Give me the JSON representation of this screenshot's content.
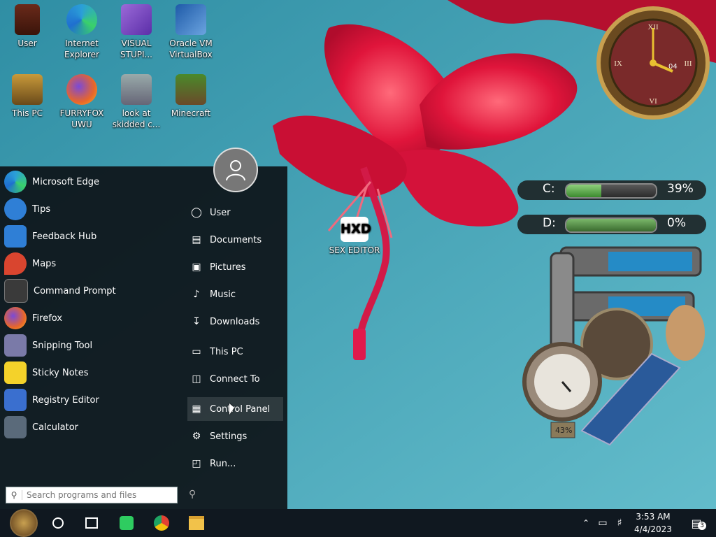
{
  "desktop_icons": [
    {
      "label": "User",
      "icon": "user-folder-icon"
    },
    {
      "label": "Internet Explorer",
      "icon": "edge-icon"
    },
    {
      "label": "VISUAL STUPI...",
      "icon": "visual-studio-icon"
    },
    {
      "label": "Oracle VM VirtualBox",
      "icon": "virtualbox-icon"
    },
    {
      "label": "This PC",
      "icon": "this-pc-icon"
    },
    {
      "label": "FURRYFOX UWU",
      "icon": "firefox-icon"
    },
    {
      "label": "look at skidded c...",
      "icon": "windows-stack-icon"
    },
    {
      "label": "Minecraft",
      "icon": "minecraft-icon"
    },
    {
      "label": "SEX EDITOR",
      "icon": "hxd-icon"
    }
  ],
  "start_menu": {
    "apps": [
      {
        "label": "Microsoft Edge",
        "icon": "edge-icon",
        "color": "#2b9fd8"
      },
      {
        "label": "Tips",
        "icon": "lightbulb-icon",
        "color": "#2f7fd6"
      },
      {
        "label": "Feedback Hub",
        "icon": "feedback-icon",
        "color": "#2f7fd6"
      },
      {
        "label": "Maps",
        "icon": "map-pin-icon",
        "color": "#d9452f"
      },
      {
        "label": "Command Prompt",
        "icon": "cmd-icon",
        "color": "#3a3a3a"
      },
      {
        "label": "Firefox",
        "icon": "firefox-icon",
        "color": "#e8662a"
      },
      {
        "label": "Snipping Tool",
        "icon": "scissors-icon",
        "color": "#7a7aa8"
      },
      {
        "label": "Sticky Notes",
        "icon": "sticky-note-icon",
        "color": "#f4d22a"
      },
      {
        "label": "Registry Editor",
        "icon": "registry-icon",
        "color": "#3a6fcf"
      },
      {
        "label": "Calculator",
        "icon": "calculator-icon",
        "color": "#5a6a7a"
      }
    ],
    "places": [
      {
        "label": "User",
        "icon": "user-icon"
      },
      {
        "label": "Documents",
        "icon": "document-icon"
      },
      {
        "label": "Pictures",
        "icon": "picture-icon"
      },
      {
        "label": "Music",
        "icon": "music-note-icon"
      },
      {
        "label": "Downloads",
        "icon": "download-icon"
      },
      {
        "label": "This PC",
        "icon": "monitor-icon"
      },
      {
        "label": "Connect To",
        "icon": "connect-icon"
      },
      {
        "label": "Control Panel",
        "icon": "control-panel-icon"
      },
      {
        "label": "Settings",
        "icon": "gear-icon"
      },
      {
        "label": "Run...",
        "icon": "run-icon"
      }
    ],
    "search_placeholder": "Search programs and files"
  },
  "gadgets": {
    "drive_c": {
      "label": "C:",
      "percent_text": "39%",
      "percent": 0.39
    },
    "drive_d": {
      "label": "D:",
      "percent_text": "0%",
      "percent": 0.0
    },
    "gauge_reading": "43%",
    "clock_date": "04"
  },
  "taskbar": {
    "time": "3:53 AM",
    "date": "4/4/2023",
    "notifications": "3"
  },
  "colors": {
    "accent": "#2b9fd8",
    "start_bg": "#0c1014",
    "taskbar": "#101820"
  }
}
